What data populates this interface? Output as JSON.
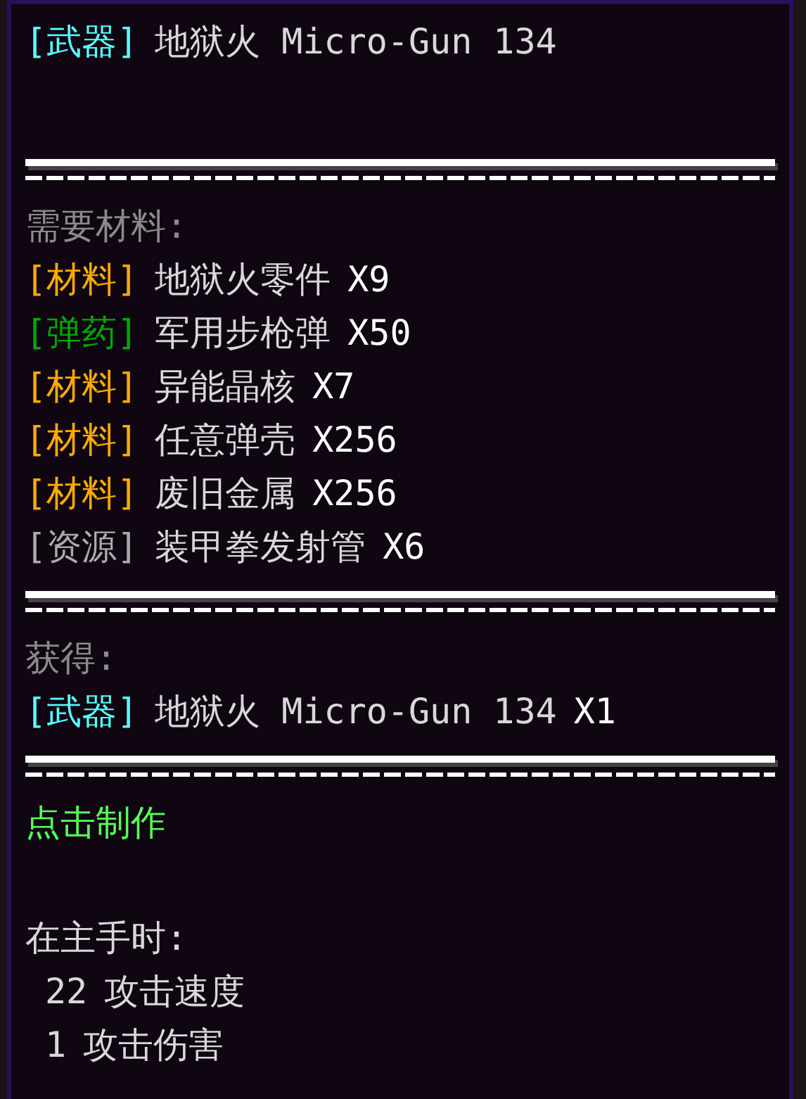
{
  "title": {
    "tag": "[武器]",
    "color": "#55ffff",
    "name": "地狱火 Micro-Gun 134"
  },
  "requirements": {
    "heading": "需要材料:",
    "items": [
      {
        "tag": "[材料]",
        "color": "#ffaa00",
        "name": "地狱火零件",
        "count": "X9"
      },
      {
        "tag": "[弹药]",
        "color": "#00aa00",
        "name": "军用步枪弹",
        "count": "X50"
      },
      {
        "tag": "[材料]",
        "color": "#ffaa00",
        "name": "异能晶核",
        "count": "X7"
      },
      {
        "tag": "[材料]",
        "color": "#ffaa00",
        "name": "任意弹壳",
        "count": "X256"
      },
      {
        "tag": "[材料]",
        "color": "#ffaa00",
        "name": "废旧金属",
        "count": "X256"
      },
      {
        "tag": "[资源]",
        "color": "#aaaaaa",
        "name": "装甲拳发射管",
        "count": "X6"
      }
    ]
  },
  "output": {
    "heading": "获得:",
    "items": [
      {
        "tag": "[武器]",
        "color": "#55ffff",
        "name": "地狱火 Micro-Gun 134",
        "count": "X1"
      }
    ]
  },
  "craft_action": "点击制作",
  "main_hand": {
    "heading": "在主手时:",
    "stats": [
      {
        "value": "22",
        "label": "攻击速度"
      },
      {
        "value": "1",
        "label": "攻击伤害"
      }
    ]
  }
}
